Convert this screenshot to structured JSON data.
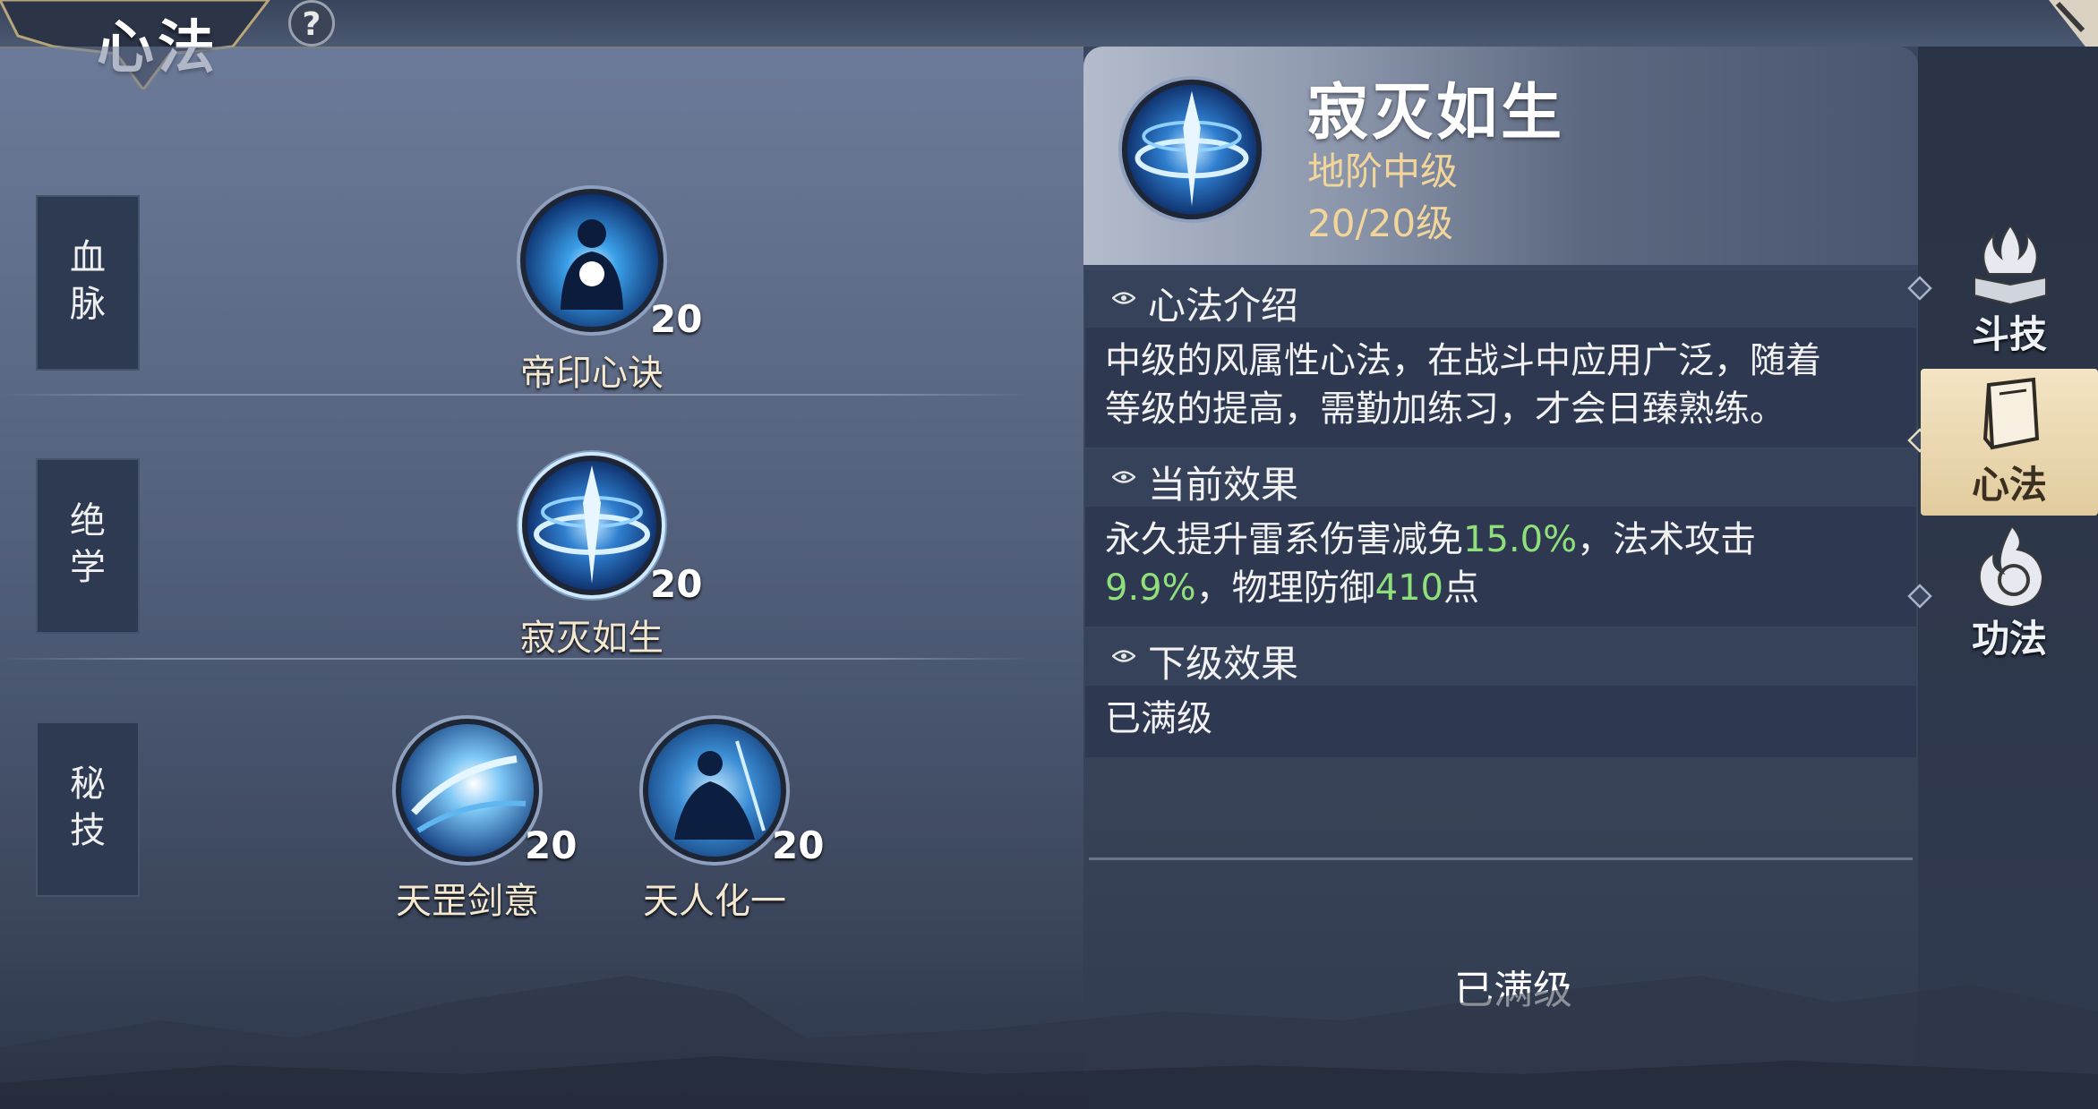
{
  "header": {
    "title": "心法",
    "help_label": "?"
  },
  "rows": [
    {
      "tag": [
        "血",
        "脉"
      ],
      "skills": [
        {
          "name": "帝印心诀",
          "level": "20"
        }
      ]
    },
    {
      "tag": [
        "绝",
        "学"
      ],
      "skills": [
        {
          "name": "寂灭如生",
          "level": "20",
          "selected": true
        }
      ]
    },
    {
      "tag": [
        "秘",
        "技"
      ],
      "skills": [
        {
          "name": "天罡剑意",
          "level": "20"
        },
        {
          "name": "天人化一",
          "level": "20"
        }
      ]
    }
  ],
  "detail": {
    "name": "寂灭如生",
    "grade": "地阶中级",
    "level": "20/20级",
    "intro_title": "心法介绍",
    "intro_lines": [
      "中级的风属性心法，在战斗中应用广泛，随着",
      "等级的提高，需勤加练习，才会日臻熟练。"
    ],
    "current_title": "当前效果",
    "current_line1": {
      "a": "永久提升雷系伤害减免",
      "v1": "15.0%",
      "b": "，法术攻击"
    },
    "current_line2": {
      "v2": "9.9%",
      "c": "，物理防御",
      "v3": "410",
      "d": "点"
    },
    "next_title": "下级效果",
    "next_text": "已满级",
    "maxed_label": "已满级"
  },
  "tabs": [
    {
      "label": "斗技",
      "icon": "flame-book-icon",
      "active": false
    },
    {
      "label": "心法",
      "icon": "scroll-book-icon",
      "active": true
    },
    {
      "label": "功法",
      "icon": "flame-swirl-icon",
      "active": false
    }
  ],
  "colors": {
    "highlight_green": "#8fe07a",
    "grade_gold": "#f2d59a",
    "active_tab": "#f3e4c4"
  }
}
